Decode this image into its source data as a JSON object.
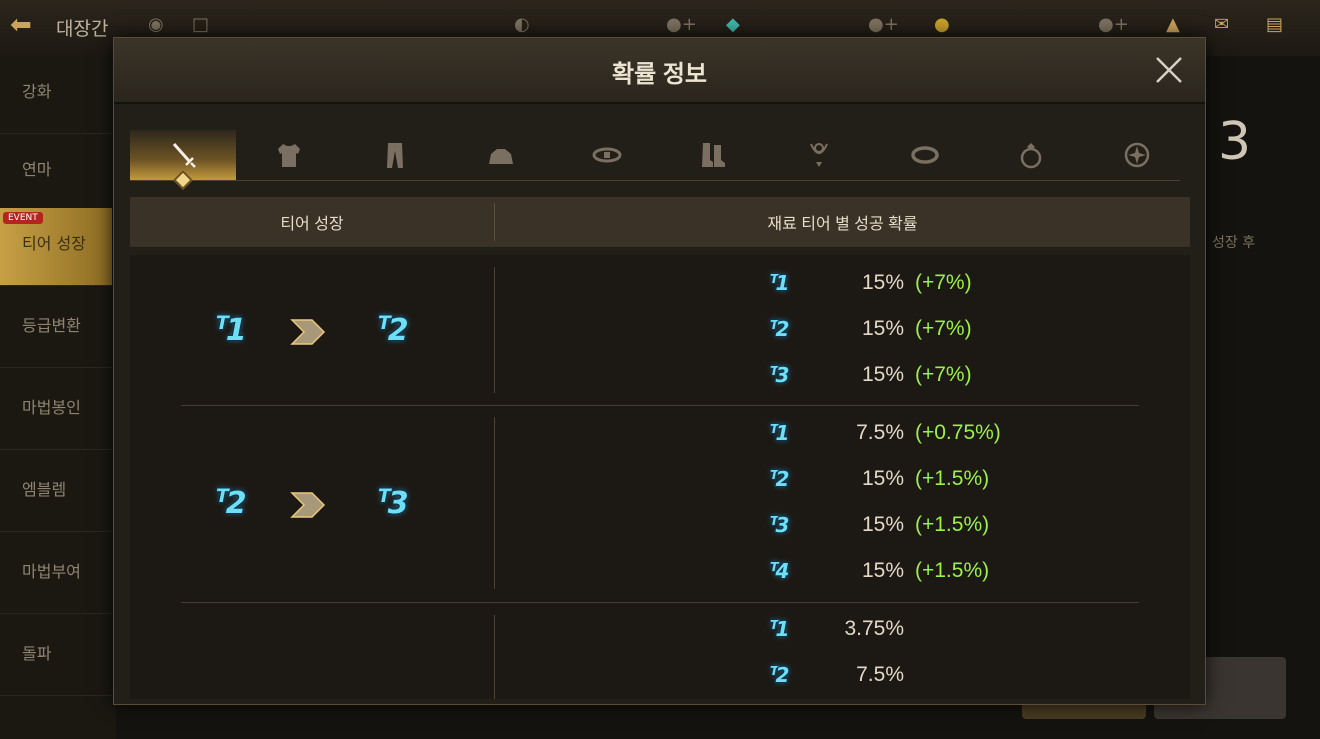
{
  "background": {
    "title": "대장간",
    "sidebar_items": [
      "강화",
      "연마",
      "티어 성장",
      "등급변환",
      "마법봉인",
      "엠블렘",
      "마법부여",
      "돌파"
    ],
    "event_badge": "EVENT",
    "right_number": "3",
    "right_text": "성장 후"
  },
  "modal": {
    "title": "확률 정보",
    "close_icon": "close-icon"
  },
  "tabs": [
    {
      "name": "weapon",
      "icon": "sword-icon",
      "active": true
    },
    {
      "name": "armor",
      "icon": "armor-icon",
      "active": false
    },
    {
      "name": "pants",
      "icon": "pants-icon",
      "active": false
    },
    {
      "name": "shoulder",
      "icon": "shoulder-icon",
      "active": false
    },
    {
      "name": "belt",
      "icon": "belt-icon",
      "active": false
    },
    {
      "name": "boots",
      "icon": "boots-icon",
      "active": false
    },
    {
      "name": "necklace",
      "icon": "necklace-icon",
      "active": false
    },
    {
      "name": "bracelet",
      "icon": "bracelet-icon",
      "active": false
    },
    {
      "name": "ring",
      "icon": "ring-icon",
      "active": false
    },
    {
      "name": "emblem",
      "icon": "emblem-icon",
      "active": false
    }
  ],
  "table": {
    "col_left": "티어 성장",
    "col_right": "재료 티어 별 성공 확률",
    "groups": [
      {
        "from": "T1",
        "to": "T2",
        "rows": [
          {
            "tier": "T1",
            "rate": "15%",
            "bonus": "(+7%)"
          },
          {
            "tier": "T2",
            "rate": "15%",
            "bonus": "(+7%)"
          },
          {
            "tier": "T3",
            "rate": "15%",
            "bonus": "(+7%)"
          }
        ]
      },
      {
        "from": "T2",
        "to": "T3",
        "rows": [
          {
            "tier": "T1",
            "rate": "7.5%",
            "bonus": "(+0.75%)"
          },
          {
            "tier": "T2",
            "rate": "15%",
            "bonus": "(+1.5%)"
          },
          {
            "tier": "T3",
            "rate": "15%",
            "bonus": "(+1.5%)"
          },
          {
            "tier": "T4",
            "rate": "15%",
            "bonus": "(+1.5%)"
          }
        ]
      },
      {
        "from": "",
        "to": "",
        "rows": [
          {
            "tier": "T1",
            "rate": "3.75%",
            "bonus": ""
          },
          {
            "tier": "T2",
            "rate": "7.5%",
            "bonus": ""
          }
        ]
      }
    ]
  },
  "colors": {
    "accent_gold": "#c39a3e",
    "tier_cyan": "#6fe0f4",
    "bonus_green": "#9cf046",
    "text_primary": "#e2d8c5"
  }
}
